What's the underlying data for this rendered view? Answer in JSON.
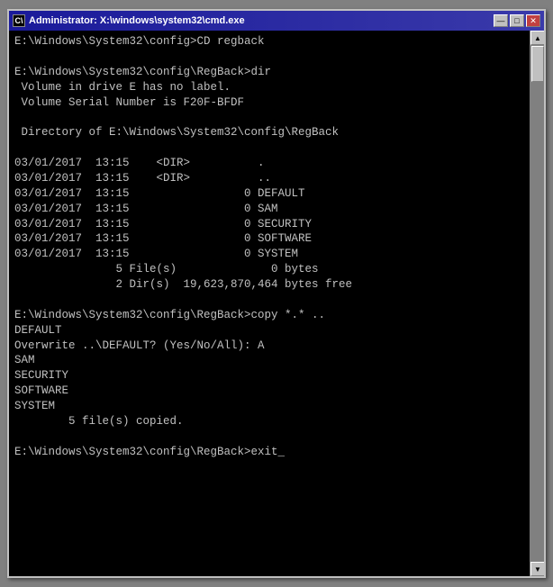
{
  "window": {
    "title": "Administrator: X:\\windows\\system32\\cmd.exe",
    "icon_label": "C:\\",
    "min_btn": "0",
    "max_btn": "1",
    "close_btn": "✕"
  },
  "console": {
    "content": "E:\\Windows\\System32\\config>CD regback\n\nE:\\Windows\\System32\\config\\RegBack>dir\n Volume in drive E has no label.\n Volume Serial Number is F20F-BFDF\n\n Directory of E:\\Windows\\System32\\config\\RegBack\n\n03/01/2017  13:15    <DIR>          .\n03/01/2017  13:15    <DIR>          ..\n03/01/2017  13:15                 0 DEFAULT\n03/01/2017  13:15                 0 SAM\n03/01/2017  13:15                 0 SECURITY\n03/01/2017  13:15                 0 SOFTWARE\n03/01/2017  13:15                 0 SYSTEM\n               5 File(s)              0 bytes\n               2 Dir(s)  19,623,870,464 bytes free\n\nE:\\Windows\\System32\\config\\RegBack>copy *.* ..\nDEFAULT\nOverwrite ..\\DEFAULT? (Yes/No/All): A\nSAM\nSECURITY\nSOFTWARE\nSYSTEM\n        5 file(s) copied.\n\nE:\\Windows\\System32\\config\\RegBack>exit_"
  }
}
